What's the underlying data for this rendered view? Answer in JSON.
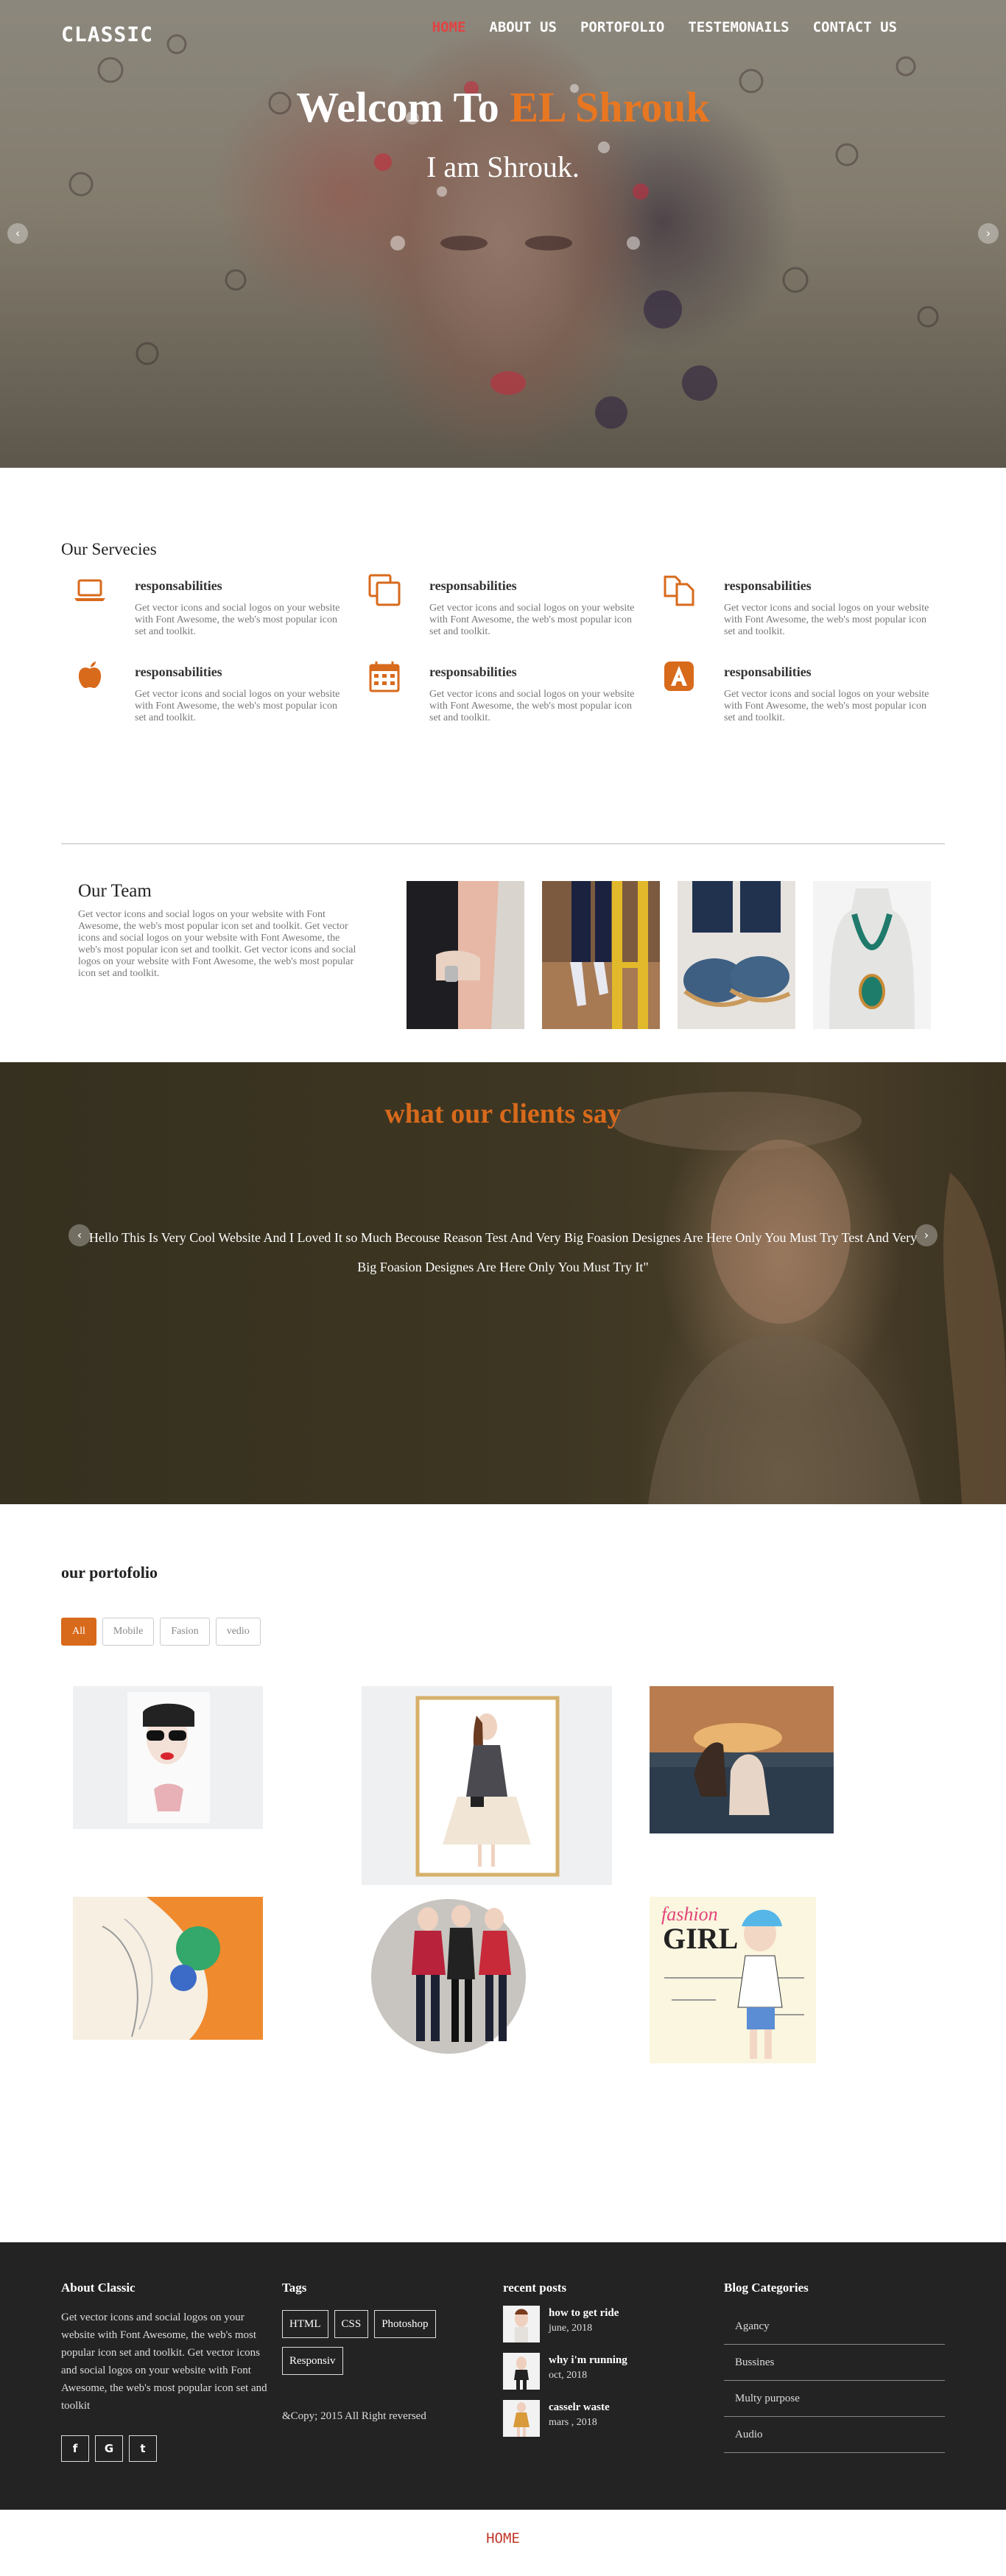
{
  "brand": "CLASSIC",
  "nav": [
    "HOME",
    "ABOUT US",
    "PORTOFOLIO",
    "TESTEMONAILS",
    "CONTACT US"
  ],
  "hero": {
    "title_pre": "Welcom To",
    "title_accent": "EL Shrouk",
    "subtitle": "I am Shrouk.",
    "prev_icon": "chevron-left-icon",
    "next_icon": "chevron-right-icon"
  },
  "services": {
    "title": "Our Servecies",
    "items": [
      {
        "icon": "laptop-icon",
        "title": "responsabilities",
        "text": "Get vector icons and social logos on your website with Font Awesome, the web's most popular icon set and toolkit."
      },
      {
        "icon": "clone-icon",
        "title": "responsabilities",
        "text": "Get vector icons and social logos on your website with Font Awesome, the web's most popular icon set and toolkit."
      },
      {
        "icon": "copy-files-icon",
        "title": "responsabilities",
        "text": "Get vector icons and social logos on your website with Font Awesome, the web's most popular icon set and toolkit."
      },
      {
        "icon": "apple-icon",
        "title": "responsabilities",
        "text": "Get vector icons and social logos on your website with Font Awesome, the web's most popular icon set and toolkit."
      },
      {
        "icon": "calendar-icon",
        "title": "responsabilities",
        "text": "Get vector icons and social logos on your website with Font Awesome, the web's most popular icon set and toolkit."
      },
      {
        "icon": "app-store-icon",
        "title": "responsabilities",
        "text": "Get vector icons and social logos on your website with Font Awesome, the web's most popular icon set and toolkit."
      }
    ]
  },
  "team": {
    "title": "Our Team",
    "text": "Get vector icons and social logos on your website with Font Awesome, the web's most popular icon set and toolkit. Get vector icons and social logos on your website with Font Awesome, the web's most popular icon set and toolkit. Get vector icons and social logos on your website with Font Awesome, the web's most popular icon set and toolkit."
  },
  "testimonials": {
    "title": "what our clients say",
    "quote": "Hello This Is Very Cool Website And I Loved It so Much Becouse Reason Test And Very Big Foasion Designes Are Here Only You Must Try Test And Very Big Foasion Designes Are Here Only You Must Try It\""
  },
  "portfolio": {
    "title": "our portofolio",
    "filters": [
      "All",
      "Mobile",
      "Fasion",
      "vedio"
    ],
    "active_filter": "All"
  },
  "footer": {
    "about_title": "About Classic",
    "about_text": "Get vector icons and social logos on your website with Font Awesome, the web's most popular icon set and toolkit. Get vector icons and social logos on your website with Font Awesome, the web's most popular icon set and toolkit",
    "socials": [
      "f",
      "G",
      "t"
    ],
    "tags_title": "Tags",
    "tags": [
      "HTML",
      "CSS",
      "Photoshop",
      "Responsiv"
    ],
    "copyright": "&Copy; 2015 All Right reversed",
    "posts_title": "recent posts",
    "posts": [
      {
        "title": "how to get ride",
        "date": "june, 2018"
      },
      {
        "title": "why i'm running",
        "date": "oct, 2018"
      },
      {
        "title": "casselr waste",
        "date": "mars , 2018"
      }
    ],
    "cats_title": "Blog Categories",
    "categories": [
      "Agancy",
      "Bussines",
      "Multy purpose",
      "Audio"
    ]
  },
  "bottom_link": "HOME",
  "colors": {
    "accent": "#d86a1c",
    "nav_active": "#e24343",
    "footer_bg": "#232323"
  }
}
